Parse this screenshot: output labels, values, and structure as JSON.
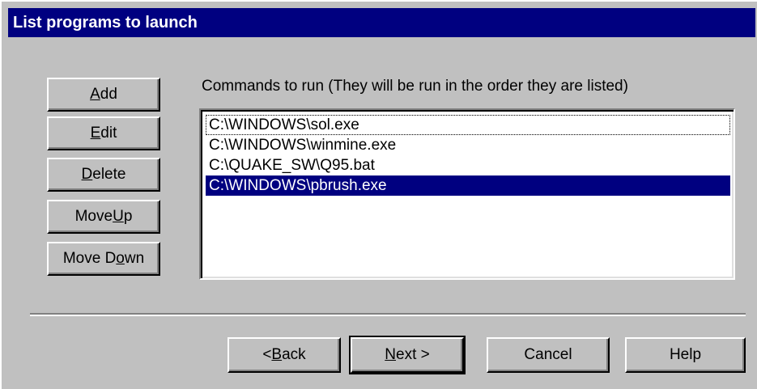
{
  "window": {
    "title": "List programs to launch"
  },
  "side_buttons": {
    "add": {
      "prefix": "",
      "hotkey": "A",
      "suffix": "dd"
    },
    "edit": {
      "prefix": "",
      "hotkey": "E",
      "suffix": "dit"
    },
    "delete": {
      "prefix": "",
      "hotkey": "D",
      "suffix": "elete"
    },
    "move_up": {
      "prefix": "Move ",
      "hotkey": "U",
      "suffix": "p"
    },
    "move_down": {
      "prefix": "Move D",
      "hotkey": "o",
      "suffix": "wn"
    }
  },
  "commands": {
    "label": "Commands to run (They will be run in the order they are listed)",
    "items": [
      "C:\\WINDOWS\\sol.exe",
      "C:\\WINDOWS\\winmine.exe",
      "C:\\QUAKE_SW\\Q95.bat",
      "C:\\WINDOWS\\pbrush.exe"
    ],
    "selected_index": 3,
    "focused_index": 0
  },
  "footer": {
    "back": {
      "prefix": "< ",
      "hotkey": "B",
      "suffix": "ack"
    },
    "next": {
      "prefix": "",
      "hotkey": "N",
      "suffix": "ext >"
    },
    "cancel_label": "Cancel",
    "help_label": "Help"
  },
  "colors": {
    "face": "#c0c0c0",
    "title_bar": "#000080",
    "selection": "#000080"
  }
}
